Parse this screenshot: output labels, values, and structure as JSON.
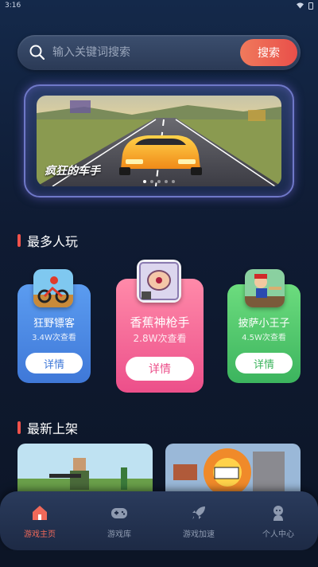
{
  "status": {
    "time": "3:16"
  },
  "search": {
    "placeholder": "输入关键词搜索",
    "button_label": "搜索"
  },
  "banner": {
    "title": "疯狂的车手",
    "dot_count": 5,
    "active_dot": 0
  },
  "sections": {
    "popular_title": "最多人玩",
    "new_title": "最新上架"
  },
  "popular_games": [
    {
      "name": "狂野镖客",
      "views": "3.4W次查看",
      "button": "详情"
    },
    {
      "name": "香蕉神枪手",
      "views": "2.8W次查看",
      "button": "详情"
    },
    {
      "name": "披萨小王子",
      "views": "4.5W次查看",
      "button": "详情"
    }
  ],
  "colors": {
    "accent": "#f0524b",
    "card_blue": "#4a86e0",
    "card_pink": "#ec4f8a",
    "card_green": "#3cb45e"
  },
  "nav": {
    "items": [
      {
        "label": "游戏主页",
        "icon": "home-icon",
        "active": true
      },
      {
        "label": "游戏库",
        "icon": "gamepad-icon",
        "active": false
      },
      {
        "label": "游戏加速",
        "icon": "rocket-icon",
        "active": false
      },
      {
        "label": "个人中心",
        "icon": "user-icon",
        "active": false
      }
    ]
  }
}
